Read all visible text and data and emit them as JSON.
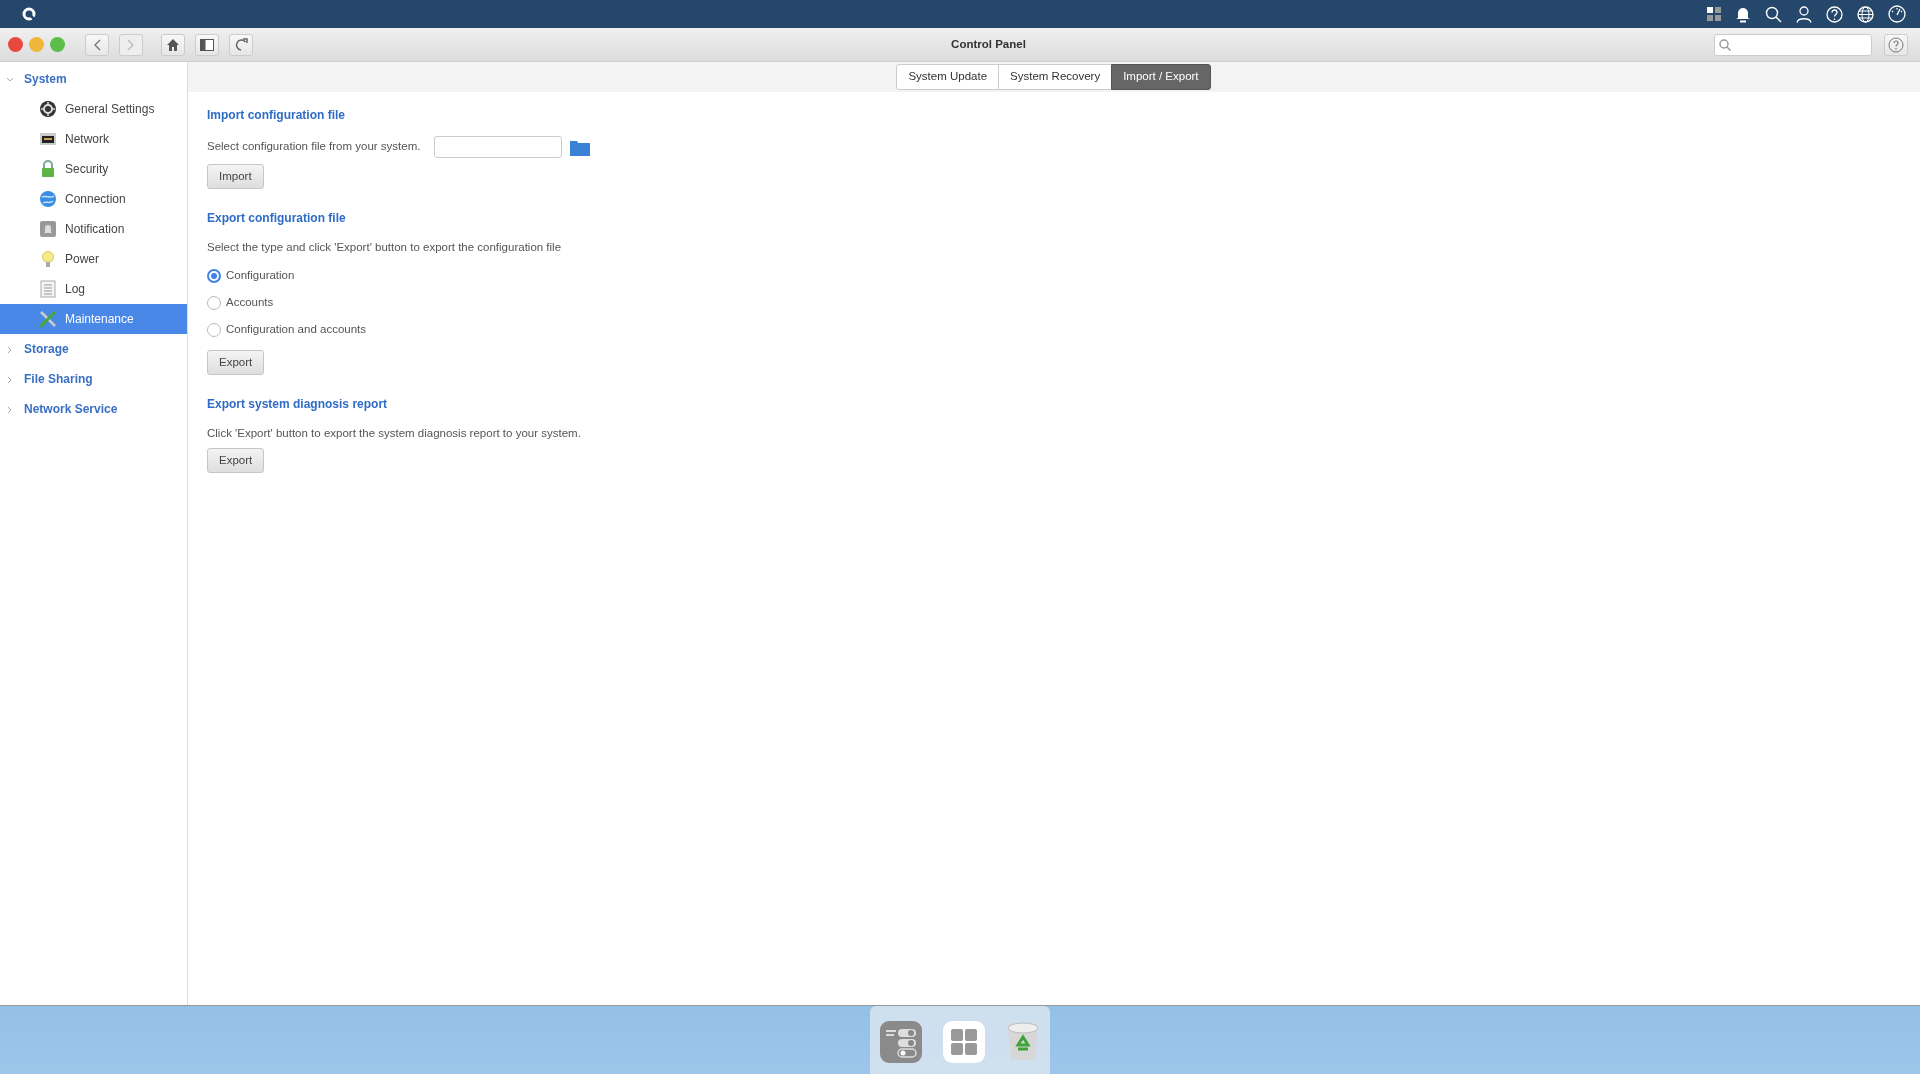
{
  "window": {
    "title": "Control Panel"
  },
  "sidebar": {
    "groups": [
      {
        "label": "System",
        "expanded": true,
        "children": [
          {
            "label": "General Settings",
            "selected": false
          },
          {
            "label": "Network",
            "selected": false
          },
          {
            "label": "Security",
            "selected": false
          },
          {
            "label": "Connection",
            "selected": false
          },
          {
            "label": "Notification",
            "selected": false
          },
          {
            "label": "Power",
            "selected": false
          },
          {
            "label": "Log",
            "selected": false
          },
          {
            "label": "Maintenance",
            "selected": true
          }
        ]
      },
      {
        "label": "Storage",
        "expanded": false
      },
      {
        "label": "File Sharing",
        "expanded": false
      },
      {
        "label": "Network Service",
        "expanded": false
      }
    ]
  },
  "tabs": [
    {
      "label": "System Update",
      "selected": false
    },
    {
      "label": "System Recovery",
      "selected": false
    },
    {
      "label": "Import / Export",
      "selected": true
    }
  ],
  "sections": [
    {
      "kind": "file",
      "heading": "Import configuration file",
      "text": "Select configuration file from your system.",
      "button": "Import"
    },
    {
      "kind": "options",
      "heading": "Export configuration file",
      "text": "Select the type and click 'Export' button to export the configuration file",
      "options": [
        {
          "label": "Configuration",
          "selected": true
        },
        {
          "label": "Accounts",
          "selected": false
        },
        {
          "label": "Configuration and accounts",
          "selected": false
        }
      ],
      "button": "Export"
    },
    {
      "kind": "plain",
      "heading": "Export system diagnosis report",
      "text": "Click 'Export' button to export the system diagnosis report to your system.",
      "button": "Export"
    }
  ]
}
